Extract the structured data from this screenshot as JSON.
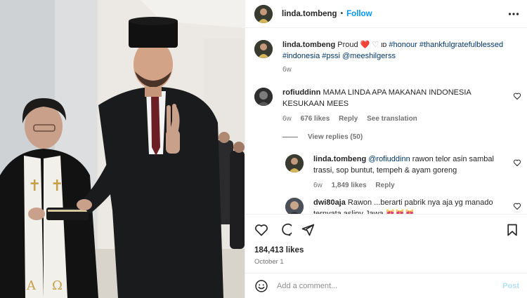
{
  "header": {
    "username": "linda.tombeng",
    "separator": "•",
    "follow_label": "Follow"
  },
  "caption": {
    "username": "linda.tombeng",
    "text_prefix": "Proud",
    "emoji_heart_red": "❤️",
    "emoji_white_heart": "♡",
    "id_flag": "ID",
    "hashtags": "#honour #thankfulgratefulblessed #indonesia #pssi @meeshilgerss",
    "time": "6w"
  },
  "comments": [
    {
      "username": "rofiuddinn",
      "text": "MAMA LINDA APA MAKANAN INDONESIA KESUKAAN MEES",
      "time": "6w",
      "likes": "676 likes",
      "reply": "Reply",
      "translate": "See translation",
      "view_replies": "View replies (50)"
    }
  ],
  "replies": [
    {
      "username": "linda.tombeng",
      "mention": "@rofiuddinn",
      "text": "rawon telor asin sambal trassi, sop buntut, tempeh & ayam goreng",
      "time": "6w",
      "likes": "1,849 likes",
      "reply": "Reply"
    },
    {
      "username": "dwi80aja",
      "text": "Rawon ...berarti pabrik nya aja yg manado ternyata asliny Jawa",
      "emojis": "😻😻😻"
    }
  ],
  "actions": {
    "likes": "184,413 likes",
    "date": "October 1"
  },
  "composer": {
    "placeholder": "Add a comment...",
    "post_label": "Post"
  },
  "colors": {
    "accent": "#0095f6",
    "hashtag": "#00376b",
    "muted": "#737373",
    "post_disabled": "#b2dffc"
  }
}
